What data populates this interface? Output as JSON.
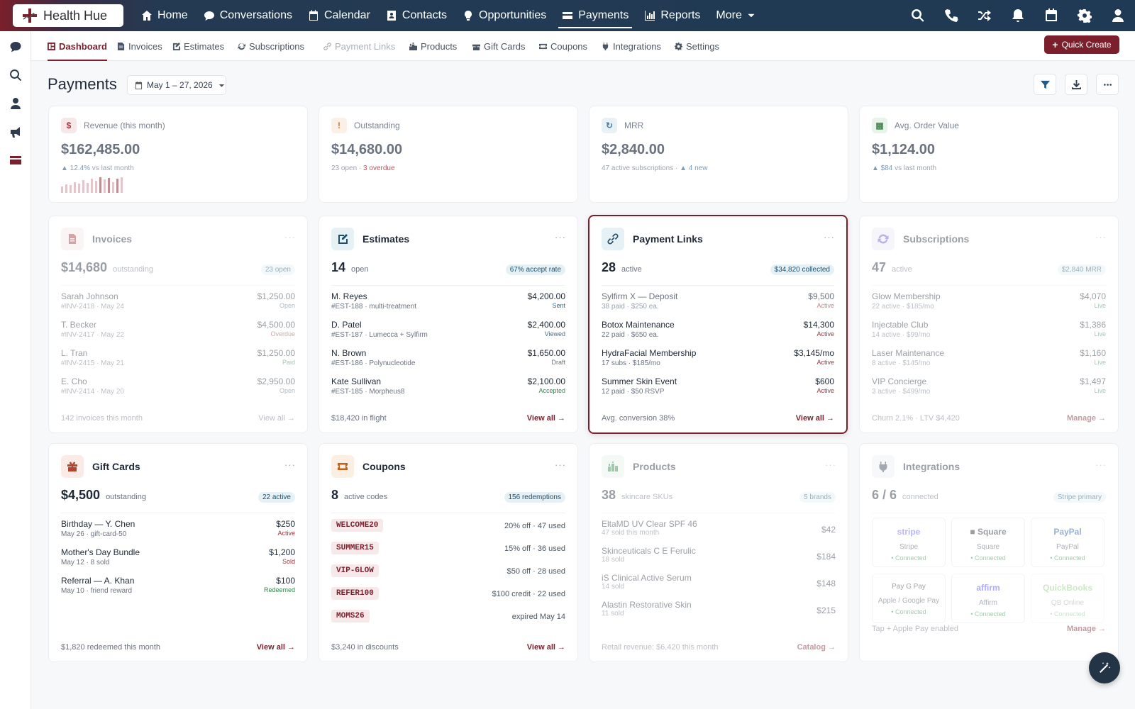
{
  "app": {
    "logo_text": "Health Hue",
    "brand_color": "#7a1f2b"
  },
  "topnav": {
    "items": [
      {
        "label": "Home",
        "icon": "home-icon"
      },
      {
        "label": "Conversations",
        "icon": "chat-icon"
      },
      {
        "label": "Calendar",
        "icon": "calendar-icon"
      },
      {
        "label": "Contacts",
        "icon": "contacts-icon"
      },
      {
        "label": "Opportunities",
        "icon": "lightbulb-icon"
      },
      {
        "label": "Payments",
        "icon": "credit-card-icon",
        "active": true
      },
      {
        "label": "Reports",
        "icon": "bar-chart-icon"
      },
      {
        "label": "More",
        "icon": "chevron-down-icon"
      }
    ],
    "right_icons": [
      "search-icon",
      "phone-icon",
      "shuffle-icon",
      "bell-icon",
      "calendar-icon",
      "gear-icon",
      "user-icon"
    ]
  },
  "sidebar": {
    "icons": [
      "chat-icon",
      "search-icon",
      "user-icon",
      "megaphone-icon",
      "credit-card-icon"
    ]
  },
  "subnav": {
    "tabs": [
      {
        "label": "Dashboard",
        "icon": "dashboard-icon",
        "active": true
      },
      {
        "label": "Invoices",
        "icon": "invoice-icon"
      },
      {
        "label": "Estimates",
        "icon": "estimate-icon"
      },
      {
        "label": "Subscriptions",
        "icon": "refresh-icon"
      },
      {
        "label": "Payment Links",
        "icon": "link-icon",
        "dim": true
      },
      {
        "label": "Products",
        "icon": "products-icon"
      },
      {
        "label": "Gift Cards",
        "icon": "gift-icon"
      },
      {
        "label": "Coupons",
        "icon": "ticket-icon"
      },
      {
        "label": "Integrations",
        "icon": "plug-icon"
      },
      {
        "label": "Settings",
        "icon": "gear-icon"
      }
    ],
    "quick_create": "Quick Create"
  },
  "header": {
    "title": "Payments",
    "date_range": "May 1 – 27, 2026",
    "actions": [
      "filter-icon",
      "download-icon",
      "more-icon"
    ]
  },
  "kpis": [
    {
      "label": "Revenue (this month)",
      "value": "$162,485.00",
      "sub_up": "▲ 12.4%",
      "sub": " vs last month",
      "icon_glyph": "$"
    },
    {
      "label": "Outstanding",
      "value": "$14,680.00",
      "sub": "23 open · ",
      "sub_red": "3 overdue",
      "icon_glyph": "!"
    },
    {
      "label": "MRR",
      "value": "$2,840.00",
      "sub": "47 active subscriptions · ",
      "sub_up": "▲ 4 new",
      "icon_glyph": "↻"
    },
    {
      "label": "Avg. Order Value",
      "value": "$1,124.00",
      "sub_up": "▲ $84",
      "sub": " vs last month",
      "icon_glyph": "▦"
    }
  ],
  "revenue_sparkline": [
    0.4,
    0.55,
    0.5,
    0.7,
    0.6,
    0.8,
    0.65,
    0.9,
    0.75,
    1.0,
    0.85,
    0.95,
    0.7,
    0.9,
    1.0
  ],
  "invoices": {
    "title": "Invoices",
    "amount": "$14,680",
    "amount_sub": "outstanding",
    "pill": "23 open",
    "rows": [
      {
        "name": "Sarah Johnson",
        "meta": "#INV-2418 · May 24",
        "amount": "$1,250.00",
        "status": "Open"
      },
      {
        "name": "T. Becker",
        "meta": "#INV-2417 · May 22",
        "amount": "$4,500.00",
        "status": "Overdue"
      },
      {
        "name": "L. Tran",
        "meta": "#INV-2415 · May 21",
        "amount": "$1,250.00",
        "status": "Paid"
      },
      {
        "name": "E. Cho",
        "meta": "#INV-2414 · May 20",
        "amount": "$2,950.00",
        "status": "Open"
      }
    ],
    "footer": "142 invoices this month",
    "link": "View all →"
  },
  "estimates": {
    "title": "Estimates",
    "amount": "14",
    "amount_sub": "open",
    "pill": "67% accept rate",
    "rows": [
      {
        "name": "M. Reyes",
        "meta": "#EST-188 · multi-treatment",
        "amount": "$4,200.00",
        "status": "Sent"
      },
      {
        "name": "D. Patel",
        "meta": "#EST-187 · Lumecca + Sylfirm",
        "amount": "$2,400.00",
        "status": "Viewed"
      },
      {
        "name": "N. Brown",
        "meta": "#EST-186 · Polynucleotide",
        "amount": "$1,650.00",
        "status": "Draft"
      },
      {
        "name": "Kate Sullivan",
        "meta": "#EST-185 · Morpheus8",
        "amount": "$2,100.00",
        "status": "Accepted"
      }
    ],
    "footer": "$18,420 in flight",
    "link": "View all →"
  },
  "payment_links": {
    "title": "Payment Links",
    "amount": "28",
    "amount_sub": "active",
    "pill": "$34,820 collected",
    "rows": [
      {
        "name": "Sylfirm X — Deposit",
        "meta": "38 paid · $250 ea.",
        "amount": "$9,500",
        "status": "Active"
      },
      {
        "name": "Botox Maintenance",
        "meta": "22 paid · $650 ea.",
        "amount": "$14,300",
        "status": "Active"
      },
      {
        "name": "HydraFacial Membership",
        "meta": "17 subs · $185/mo",
        "amount": "$3,145/mo",
        "status": "Active"
      },
      {
        "name": "Summer Skin Event",
        "meta": "12 paid · $50 RSVP",
        "amount": "$600",
        "status": "Active"
      }
    ],
    "footer": "Avg. conversion 38%",
    "link": "View all →"
  },
  "subscriptions": {
    "title": "Subscriptions",
    "amount": "47",
    "amount_sub": "active",
    "pill": "$2,840 MRR",
    "rows": [
      {
        "name": "Glow Membership",
        "meta": "22 active · $185/mo",
        "amount": "$4,070",
        "status": "Live"
      },
      {
        "name": "Injectable Club",
        "meta": "14 active · $99/mo",
        "amount": "$1,386",
        "status": "Live"
      },
      {
        "name": "Laser Maintenance",
        "meta": "8 active · $145/mo",
        "amount": "$1,160",
        "status": "Live"
      },
      {
        "name": "VIP Concierge",
        "meta": "3 active · $499/mo",
        "amount": "$1,497",
        "status": "Live"
      }
    ],
    "footer": "Churn 2.1% · LTV $4,420",
    "link": "Manage →"
  },
  "gift_cards": {
    "title": "Gift Cards",
    "amount": "$4,500",
    "amount_sub": "outstanding",
    "pill": "22 active",
    "rows": [
      {
        "name": "Birthday — Y. Chen",
        "meta": "May 26 · gift-card-50",
        "amount": "$250",
        "status": "Active"
      },
      {
        "name": "Mother's Day Bundle",
        "meta": "May 12 · 8 sold",
        "amount": "$1,200",
        "status": "Sold"
      },
      {
        "name": "Referral — A. Khan",
        "meta": "May 10 · friend reward",
        "amount": "$100",
        "status": "Redeemed"
      }
    ],
    "footer": "$1,820 redeemed this month",
    "link": "View all →"
  },
  "coupons": {
    "title": "Coupons",
    "amount": "8",
    "amount_sub": "active codes",
    "pill": "156 redemptions",
    "rows": [
      {
        "code": "WELCOME20",
        "desc": "20% off · 47 used"
      },
      {
        "code": "SUMMER15",
        "desc": "15% off · 36 used"
      },
      {
        "code": "VIP-GLOW",
        "desc": "$50 off · 28 used"
      },
      {
        "code": "REFER100",
        "desc": "$100 credit · 22 used"
      },
      {
        "code": "MOMS26",
        "desc": "expired May 14"
      }
    ],
    "footer": "$3,240 in discounts",
    "link": "View all →"
  },
  "products": {
    "title": "Products",
    "amount": "38",
    "amount_sub": "skincare SKUs",
    "pill": "5 brands",
    "rows": [
      {
        "name": "EltaMD UV Clear SPF 46",
        "meta": "47 sold this month",
        "amount": "$42"
      },
      {
        "name": "Skinceuticals C E Ferulic",
        "meta": "18 sold",
        "amount": "$184"
      },
      {
        "name": "iS Clinical Active Serum",
        "meta": "14 sold",
        "amount": "$148"
      },
      {
        "name": "Alastin Restorative Skin",
        "meta": "11 sold",
        "amount": "$215"
      }
    ],
    "footer": "Retail revenue: $6,420 this month",
    "link": "Catalog →"
  },
  "integrations": {
    "title": "Integrations",
    "amount": "6 / 6",
    "amount_sub": "connected",
    "pill": "Stripe primary",
    "items": [
      {
        "brand": "stripe",
        "name": "Stripe",
        "status": "• Connected",
        "color": "#635bff"
      },
      {
        "brand": "■ Square",
        "name": "Square",
        "status": "• Connected",
        "color": "#1f2937"
      },
      {
        "brand": "PayPal",
        "name": "PayPal",
        "status": "• Connected",
        "color": "#1e4f9a"
      },
      {
        "brand": "Pay  G Pay",
        "name": "Apple / Google Pay",
        "status": "• Connected",
        "color": "#333333"
      },
      {
        "brand": "affirm",
        "name": "Affirm",
        "status": "• Connected",
        "color": "#4a4af4"
      },
      {
        "brand": "QuickBooks",
        "name": "QB Online",
        "status": "• Connected",
        "color": "#2ca01c"
      }
    ],
    "footer": "Tap + Apple Pay enabled",
    "link": "Manage →"
  }
}
